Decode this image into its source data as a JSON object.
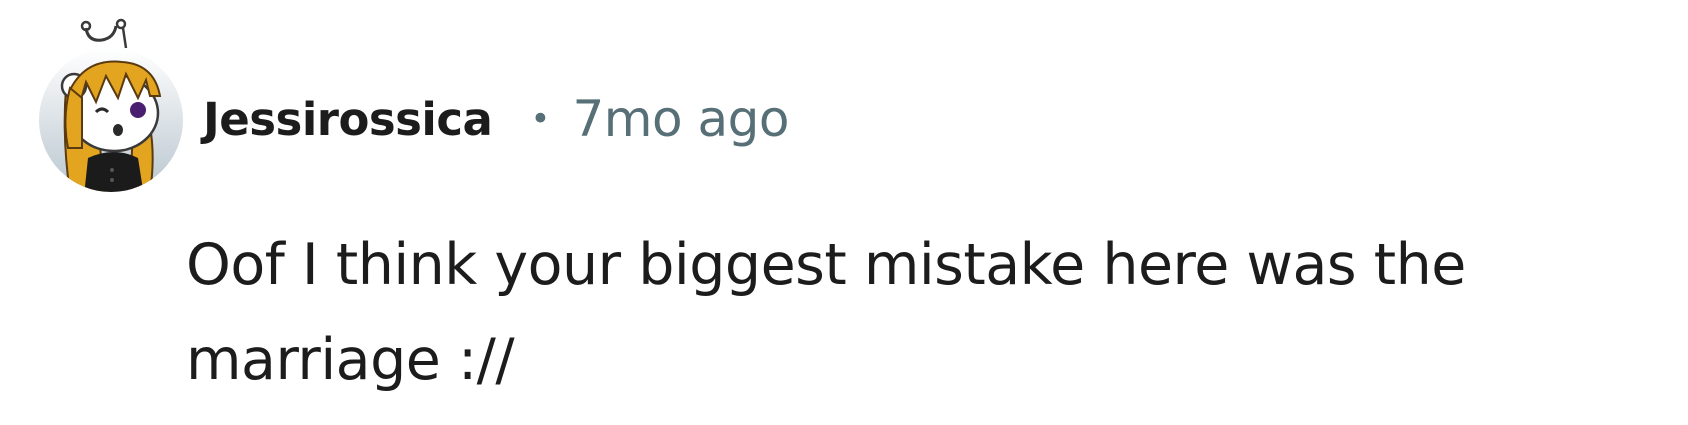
{
  "comment": {
    "username": "Jessirossica",
    "separator": "•",
    "timestamp": "7mo ago",
    "text": "Oof I think your biggest mistake here was the marriage ://"
  },
  "colors": {
    "text_primary": "#1c1c1c",
    "text_meta": "#576f76",
    "background": "#ffffff"
  },
  "icons": {
    "avatar": "snoo-avatar-icon"
  }
}
